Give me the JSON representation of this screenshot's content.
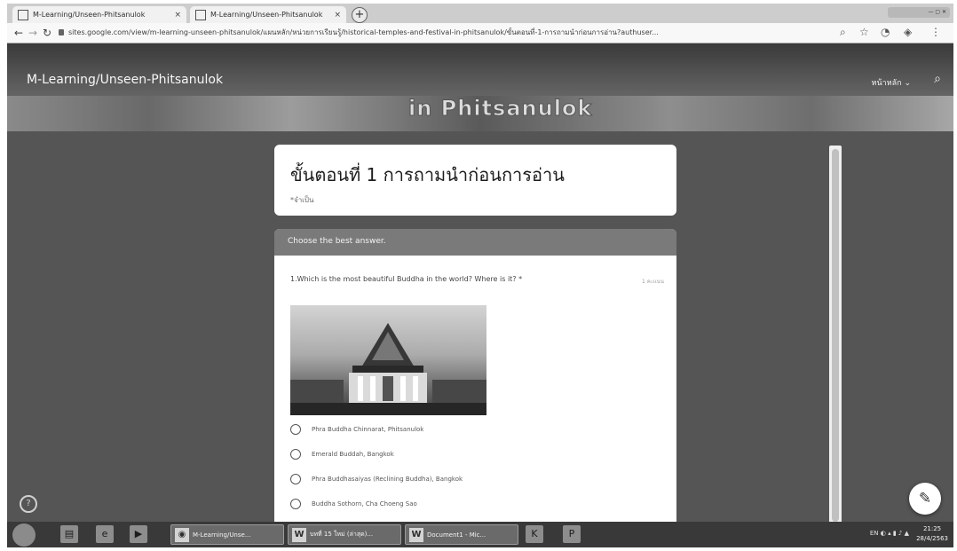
{
  "browser": {
    "tabs": [
      {
        "title": "M-Learning/Unseen-Phitsanulok",
        "close": "×"
      },
      {
        "title": "M-Learning/Unseen-Phitsanulok",
        "close": "×"
      }
    ],
    "new_tab": "+",
    "url": "sites.google.com/view/m-learning-unseen-phitsanulok/แผนหลัก/หน่วยการเรียนรู้/historical-temples-and-festival-in-phitsanulok/ขั้นตอนที่-1-การถามนำก่อนการอ่าน?authuser..."
  },
  "site": {
    "title": "M-Learning/Unseen-Phitsanulok",
    "menu": "หน้าหลัก",
    "banner_text": "in Phitsanulok"
  },
  "form": {
    "section_title": "ขั้นตอนที่ 1 การถามนำก่อนการอ่าน",
    "required_note": "*จำเป็น",
    "header": "Choose the best answer.",
    "question": "1.Which is the most beautiful Buddha in the world? Where is it? *",
    "points": "1 คะแนน",
    "options": [
      "Phra Buddha Chinnarat, Phitsanulok",
      "Emerald Buddah, Bangkok",
      "Phra Buddhasaiyas (Reclining Buddha), Bangkok",
      "Buddha Sothorn, Cha Choeng Sao"
    ]
  },
  "taskbar": {
    "apps": [
      {
        "label": "M-Learning/Unse...",
        "icon": "chrome-icon"
      },
      {
        "label": "บทที่ 15 ใหม่ (ล่าสุด)...",
        "icon": "W"
      },
      {
        "label": "Document1 - Mic...",
        "icon": "W"
      }
    ],
    "tray_lang": "EN",
    "time": "21:25",
    "date": "28/4/2563"
  },
  "colors": {
    "header_bar": "#7a7a7a",
    "page_bg": "#575757"
  }
}
